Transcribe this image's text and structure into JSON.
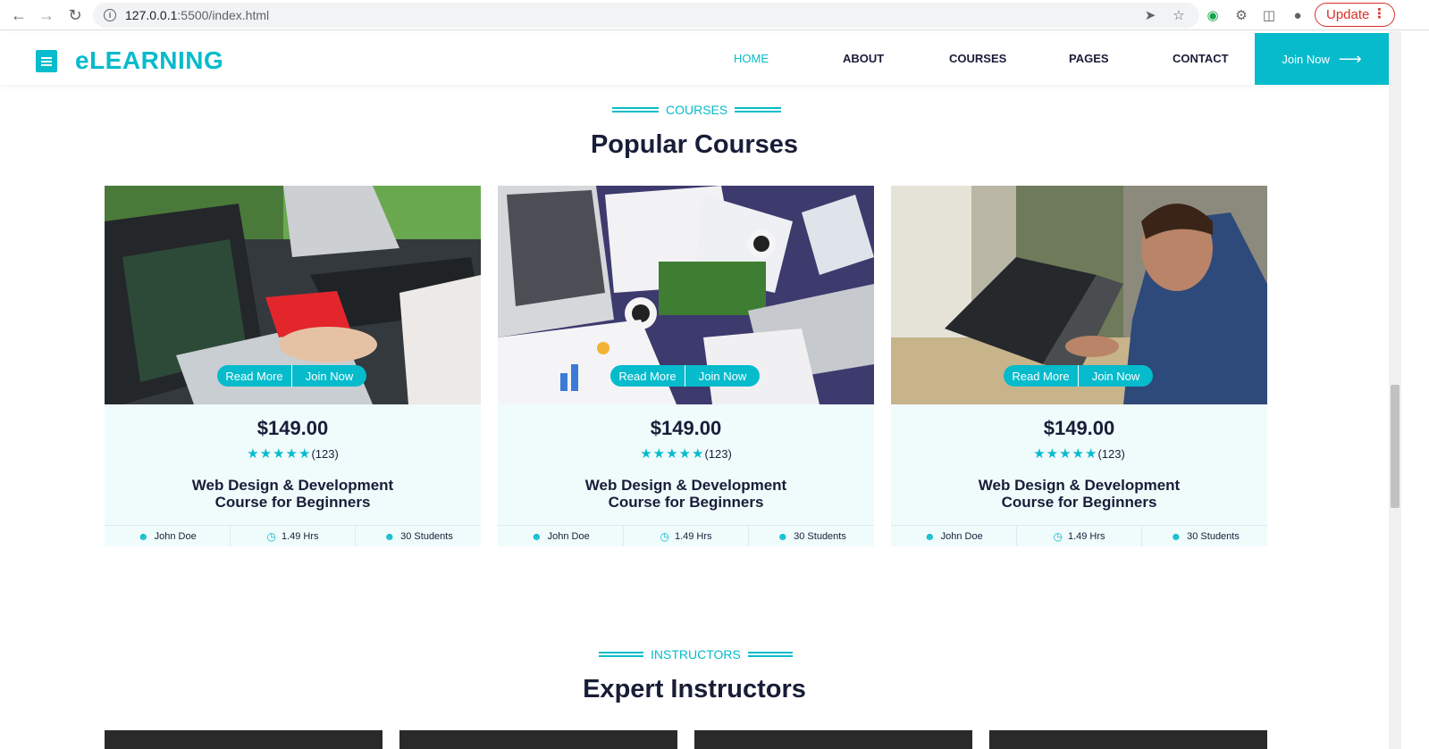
{
  "browser": {
    "url_host": "127.0.0.1",
    "url_rest": ":5500/index.html",
    "update_label": "Update"
  },
  "navbar": {
    "brand": "eLEARNING",
    "links": [
      "HOME",
      "ABOUT",
      "COURSES",
      "PAGES",
      "CONTACT"
    ],
    "active": "HOME",
    "cta": "Join Now"
  },
  "courses_section": {
    "tag": "COURSES",
    "title": "Popular Courses",
    "cards": [
      {
        "read_more": "Read More",
        "join_now": "Join Now",
        "price": "$149.00",
        "reviews": "(123)",
        "title_line1": "Web Design & Development",
        "title_line2": "Course for Beginners",
        "instructor": "John Doe",
        "duration": "1.49 Hrs",
        "students": "30 Students"
      },
      {
        "read_more": "Read More",
        "join_now": "Join Now",
        "price": "$149.00",
        "reviews": "(123)",
        "title_line1": "Web Design & Development",
        "title_line2": "Course for Beginners",
        "instructor": "John Doe",
        "duration": "1.49 Hrs",
        "students": "30 Students"
      },
      {
        "read_more": "Read More",
        "join_now": "Join Now",
        "price": "$149.00",
        "reviews": "(123)",
        "title_line1": "Web Design & Development",
        "title_line2": "Course for Beginners",
        "instructor": "John Doe",
        "duration": "1.49 Hrs",
        "students": "30 Students"
      }
    ]
  },
  "instructors_section": {
    "tag": "INSTRUCTORS",
    "title": "Expert Instructors"
  },
  "colors": {
    "accent": "#06bbcc",
    "dark": "#181d38",
    "card_bg": "#f0fbfc"
  }
}
